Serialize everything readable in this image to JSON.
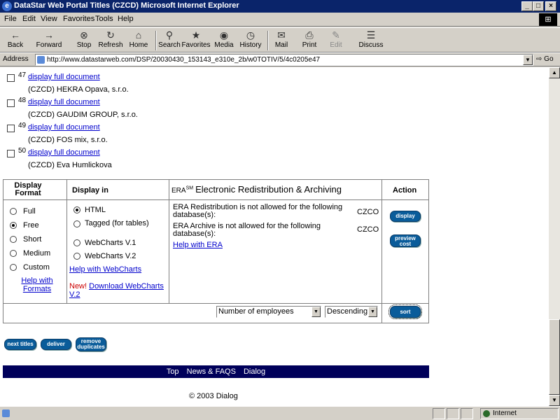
{
  "window": {
    "title": "DataStar Web Portal   Titles (CZCD)   Microsoft Internet Explorer",
    "min": "_",
    "max": "□",
    "close": "×"
  },
  "menu": [
    "File",
    "Edit",
    "View",
    "Favorites",
    "Tools",
    "Help"
  ],
  "toolbar": [
    {
      "icon": "←",
      "label": "Back",
      "disabled": false
    },
    {
      "icon": "→",
      "label": "Forward",
      "disabled": false
    },
    {
      "icon": "⊗",
      "label": "Stop",
      "disabled": false
    },
    {
      "icon": "↻",
      "label": "Refresh",
      "disabled": false
    },
    {
      "icon": "⌂",
      "label": "Home",
      "disabled": false
    },
    {
      "icon": "⚲",
      "label": "Search",
      "disabled": false
    },
    {
      "icon": "★",
      "label": "Favorites",
      "disabled": false
    },
    {
      "icon": "◉",
      "label": "Media",
      "disabled": false
    },
    {
      "icon": "◷",
      "label": "History",
      "disabled": false
    },
    {
      "icon": "✉",
      "label": "Mail",
      "disabled": false
    },
    {
      "icon": "⎙",
      "label": "Print",
      "disabled": false
    },
    {
      "icon": "✎",
      "label": "Edit",
      "disabled": true
    },
    {
      "icon": "☰",
      "label": "Discuss",
      "disabled": false
    }
  ],
  "address": {
    "label": "Address",
    "url": "http://www.datastarweb.com/DSP/20030430_153143_e310e_2b/w0TOTIV/5/4c0205e47",
    "go": "Go"
  },
  "records": [
    {
      "num": "47",
      "link": "display full document",
      "name": "(CZCD) HEKRA Opava, s.r.o."
    },
    {
      "num": "48",
      "link": "display full document",
      "name": "(CZCD) GAUDIM GROUP, s.r.o."
    },
    {
      "num": "49",
      "link": "display full document",
      "name": "(CZCD) FOS mix, s.r.o."
    },
    {
      "num": "50",
      "link": "display full document",
      "name": "(CZCD) Eva Humlickova"
    }
  ],
  "format": {
    "col_display_format": "Display Format",
    "col_display_in": "Display in",
    "col_era_prefix": "ERA",
    "col_era_sm": "SM",
    "col_era": "Electronic Redistribution & Archiving",
    "col_action": "Action",
    "formats": [
      {
        "label": "Full",
        "checked": false
      },
      {
        "label": "Free",
        "checked": true
      },
      {
        "label": "Short",
        "checked": false
      },
      {
        "label": "Medium",
        "checked": false
      },
      {
        "label": "Custom",
        "checked": false
      }
    ],
    "help_formats": "Help with Formats",
    "display_in": [
      {
        "label": "HTML",
        "checked": true
      },
      {
        "label": "Tagged (for tables)",
        "checked": false
      },
      {
        "label": "WebCharts V.1",
        "checked": false
      },
      {
        "label": "WebCharts V.2",
        "checked": false
      }
    ],
    "help_webcharts": "Help with WebCharts",
    "new_label": "New!",
    "download_webcharts": "Download WebCharts V.2",
    "era_redistribution": "ERA Redistribution is not allowed for the following database(s):",
    "era_archive": "ERA Archive is not allowed for the following database(s):",
    "db_code_1": "CZCO",
    "db_code_2": "CZCO",
    "help_era": "Help with ERA",
    "btn_display": "display",
    "btn_preview": "preview cost",
    "sort_field": "Number of employees",
    "sort_order": "Descending",
    "btn_sort": "sort"
  },
  "actions": {
    "next_titles": "next titles",
    "deliver": "deliver",
    "remove_duplicates": "remove duplicates"
  },
  "footer": {
    "top": "Top",
    "news": "News & FAQS",
    "dialog": "Dialog",
    "copyright": "© 2003 Dialog"
  },
  "status": {
    "zone": "Internet"
  },
  "colors": {
    "titlebar": "#0a246a",
    "footerbar": "#00005a",
    "button": "#0a5c9a",
    "link": "#0000cc"
  }
}
